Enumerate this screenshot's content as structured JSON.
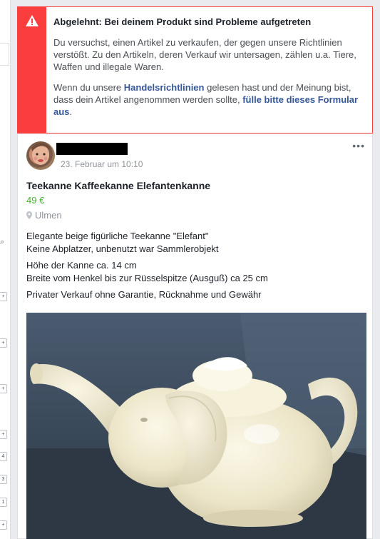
{
  "alert": {
    "title": "Abgelehnt: Bei deinem Produkt sind Probleme aufgetreten",
    "paragraph1": "Du versuchst, einen Artikel zu verkaufen, der gegen unsere Richtlinien verstößt. Zu den Artikeln, deren Verkauf wir untersagen, zählen u.a. Tiere, Waffen und illegale Waren.",
    "paragraph2_before": "Wenn du unsere ",
    "paragraph2_link1": "Handelsrichtlinien",
    "paragraph2_middle": " gelesen hast und der Meinung bist, dass dein Artikel angenommen werden sollte, ",
    "paragraph2_link2": "fülle bitte dieses Formular aus",
    "paragraph2_after": ".",
    "icon": "warning-icon",
    "color": "#fa3e3e"
  },
  "post": {
    "timestamp": "23. Februar um 10:10",
    "more_icon": "•••",
    "title": "Teekanne Kaffeekanne Elefantenkanne",
    "price": "49 €",
    "location": "Ulmen",
    "description": [
      "Elegante beige figürliche Teekanne \"Elefant\"\nKeine Abplatzer, unbenutzt war Sammlerobjekt",
      "Höhe der Kanne ca. 14 cm\nBreite vom Henkel bis zur Rüsselspitze (Ausguß) ca 25 cm",
      "Privater Verkauf ohne Garantie, Rücknahme und Gewähr"
    ],
    "price_color": "#42b72a"
  },
  "sidebar": {
    "badges": [
      "+",
      "+",
      "+",
      "+",
      "4",
      "3",
      "1",
      "+"
    ]
  }
}
